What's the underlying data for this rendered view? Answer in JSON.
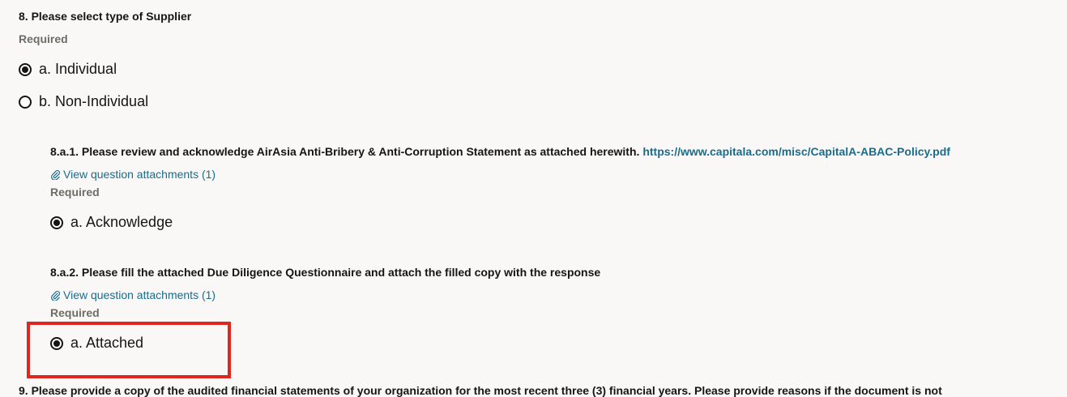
{
  "q8": {
    "title": "8. Please select type of Supplier",
    "required": "Required",
    "options": [
      "a. Individual",
      "b. Non-Individual"
    ],
    "selected": "a. Individual"
  },
  "q8a1": {
    "title": "8.a.1. Please review and acknowledge AirAsia Anti-Bribery & Anti-Corruption Statement as attached herewith. ",
    "link": "https://www.capitala.com/misc/CapitalA-ABAC-Policy.pdf",
    "attachments": "View question attachments (1)",
    "required": "Required",
    "option": "a. Acknowledge"
  },
  "q8a2": {
    "title": "8.a.2. Please fill the attached Due Diligence Questionnaire and attach the filled copy with the response",
    "attachments": "View question attachments (1)",
    "required": "Required",
    "option": "a. Attached"
  },
  "q9": {
    "title": "9. Please provide a copy of the audited financial statements of your organization for the most recent three (3) financial years. Please provide reasons if the document is not"
  },
  "colors": {
    "link": "#1a6c8d",
    "highlight": "#e0261f",
    "muted": "#6f6c67"
  }
}
